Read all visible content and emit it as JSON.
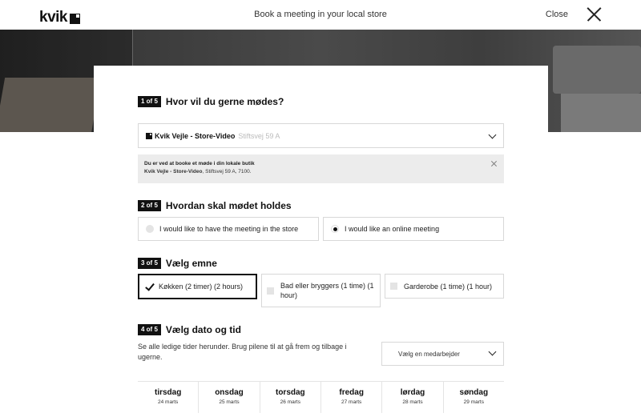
{
  "header": {
    "logo_text": "kvik",
    "title": "Book a meeting in your local store",
    "close_label": "Close"
  },
  "step1": {
    "badge": "1 of 5",
    "title": "Hvor vil du gerne mødes?",
    "store_name": "Kvik Vejle - Store-Video",
    "store_address": "Stiftsvej 59 A",
    "info_line1": "Du er ved at booke et møde i din lokale butik",
    "info_store": "Kvik Vejle - Store-Video",
    "info_address": ", Stiftsvej 59 A, 7100."
  },
  "step2": {
    "badge": "2 of 5",
    "title": "Hvordan skal mødet holdes",
    "options": [
      {
        "label": "I would like to have the meeting in the store",
        "selected": false
      },
      {
        "label": "I would like an online meeting",
        "selected": true
      }
    ]
  },
  "step3": {
    "badge": "3 of 5",
    "title": "Vælg emne",
    "options": [
      {
        "label": "Køkken (2 timer) (2 hours)",
        "selected": true
      },
      {
        "label": "Bad eller bryggers (1 time) (1 hour)",
        "selected": false
      },
      {
        "label": "Garderobe (1 time) (1 hour)",
        "selected": false
      }
    ]
  },
  "step4": {
    "badge": "4 of 5",
    "title": "Vælg dato og tid",
    "description": "Se alle ledige tider herunder. Brug pilene til at gå frem og tilbage i ugerne.",
    "employee_select": "Vælg en medarbejder",
    "days": [
      {
        "name": "tirsdag",
        "date": "24 marts"
      },
      {
        "name": "onsdag",
        "date": "25 marts"
      },
      {
        "name": "torsdag",
        "date": "26 marts"
      },
      {
        "name": "fredag",
        "date": "27 marts"
      },
      {
        "name": "lørdag",
        "date": "28 marts"
      },
      {
        "name": "søndag",
        "date": "29 marts"
      }
    ]
  }
}
